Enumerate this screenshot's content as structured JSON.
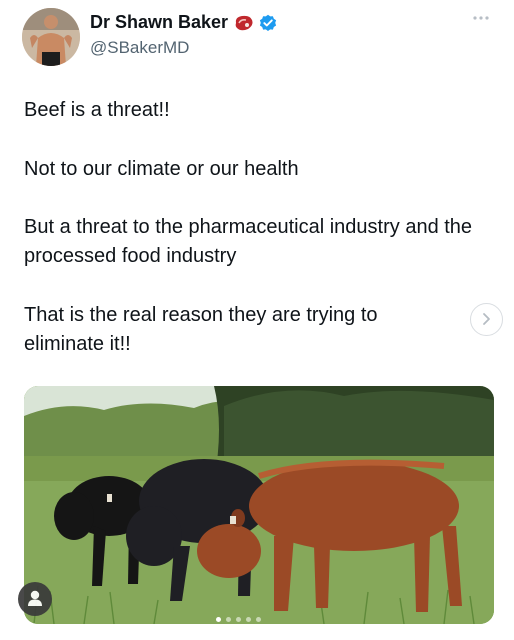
{
  "author": {
    "display_name": "Dr Shawn Baker",
    "handle": "@SBakerMD",
    "avatar_icon": "profile-photo",
    "badges": [
      "steak-icon",
      "verified-icon"
    ],
    "verified_color": "#1d9bf0"
  },
  "tweet": {
    "paragraphs": [
      "Beef is a threat!!",
      "Not to our climate or our health",
      "But a threat to the pharmaceutical industry and the processed food industry",
      "That is the real reason they are trying to eliminate it!!"
    ]
  },
  "media": {
    "image_icon": "cattle-grazing-photo",
    "carousel_dots": 5,
    "active_dot": 1
  },
  "controls": {
    "more_icon": "more-icon",
    "next_icon": "chevron-right-icon",
    "user_icon": "user-icon"
  }
}
